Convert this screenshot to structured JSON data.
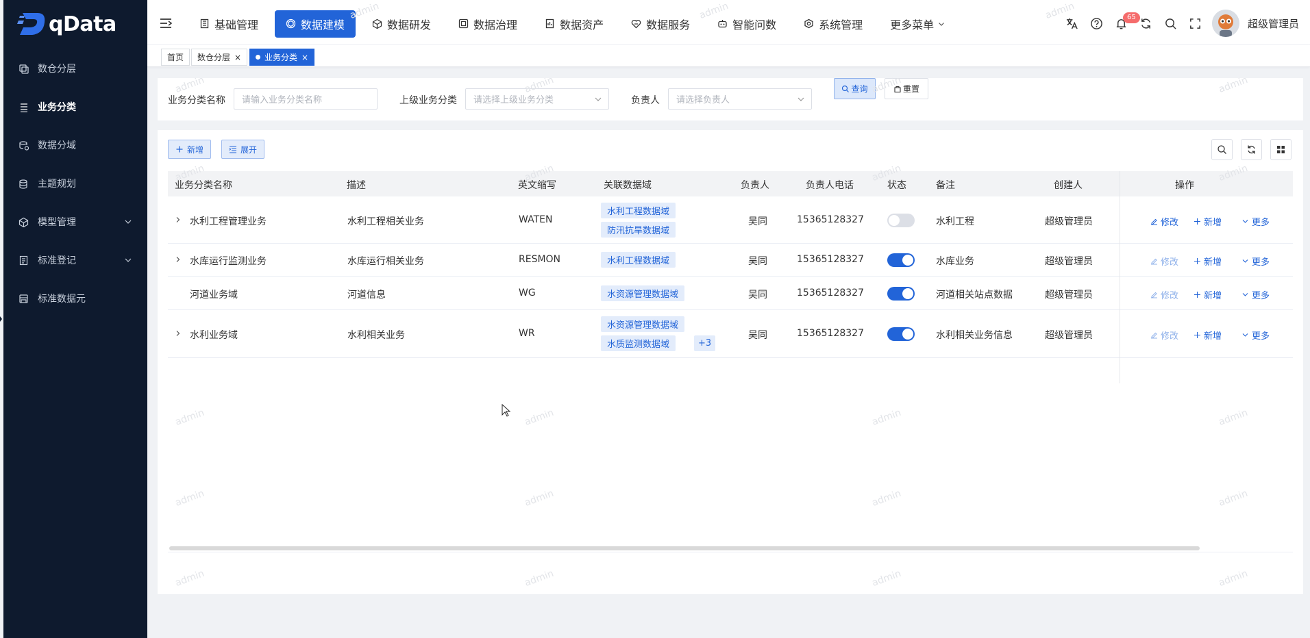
{
  "app": {
    "logo_text": "qData"
  },
  "sidebar": {
    "items": [
      {
        "label": "数仓分层",
        "icon": "layers-icon",
        "active": false,
        "has_children": false
      },
      {
        "label": "业务分类",
        "icon": "list-icon",
        "active": true,
        "has_children": false
      },
      {
        "label": "数据分域",
        "icon": "database-domain-icon",
        "active": false,
        "has_children": false
      },
      {
        "label": "主题规划",
        "icon": "topic-icon",
        "active": false,
        "has_children": false
      },
      {
        "label": "模型管理",
        "icon": "cube-icon",
        "active": false,
        "has_children": true
      },
      {
        "label": "标准登记",
        "icon": "doc-icon",
        "active": false,
        "has_children": true
      },
      {
        "label": "标准数据元",
        "icon": "save-icon",
        "active": false,
        "has_children": false
      }
    ]
  },
  "topnav": {
    "items": [
      {
        "label": "基础管理",
        "icon": "building-icon",
        "active": false
      },
      {
        "label": "数据建模",
        "icon": "model-icon",
        "active": true
      },
      {
        "label": "数据研发",
        "icon": "cube-icon",
        "active": false
      },
      {
        "label": "数据治理",
        "icon": "govern-icon",
        "active": false
      },
      {
        "label": "数据资产",
        "icon": "asset-icon",
        "active": false
      },
      {
        "label": "数据服务",
        "icon": "service-icon",
        "active": false
      },
      {
        "label": "智能问数",
        "icon": "robot-icon",
        "active": false
      },
      {
        "label": "系统管理",
        "icon": "settings-icon",
        "active": false
      },
      {
        "label": "更多菜单",
        "icon": "",
        "active": false,
        "dropdown": true
      }
    ]
  },
  "header": {
    "notification_count": "65",
    "username": "超级管理员"
  },
  "tags": [
    {
      "label": "首页",
      "closable": false,
      "active": false
    },
    {
      "label": "数仓分层",
      "closable": true,
      "active": false
    },
    {
      "label": "业务分类",
      "closable": true,
      "active": true
    }
  ],
  "search": {
    "name_label": "业务分类名称",
    "name_placeholder": "请输入业务分类名称",
    "parent_label": "上级业务分类",
    "parent_placeholder": "请选择上级业务分类",
    "owner_label": "负责人",
    "owner_placeholder": "请选择负责人",
    "query_label": "查询",
    "reset_label": "重置"
  },
  "toolbar": {
    "add_label": "新增",
    "expand_label": "展开"
  },
  "table": {
    "columns": [
      "业务分类名称",
      "描述",
      "英文缩写",
      "关联数据域",
      "负责人",
      "负责人电话",
      "状态",
      "备注",
      "创建人",
      "操作"
    ],
    "rows": [
      {
        "name": "水利工程管理业务",
        "desc": "水利工程相关业务",
        "abbr": "WATEN",
        "domains": [
          "水利工程数据域",
          "防汛抗旱数据域"
        ],
        "extra": "",
        "owner": "吴同",
        "phone": "15365128327",
        "status": false,
        "remark": "水利工程",
        "creator": "超级管理员",
        "expandable": true
      },
      {
        "name": "水库运行监测业务",
        "desc": "水库运行相关业务",
        "abbr": "RESMON",
        "domains": [
          "水利工程数据域"
        ],
        "extra": "",
        "owner": "吴同",
        "phone": "15365128327",
        "status": true,
        "remark": "水库业务",
        "creator": "超级管理员",
        "expandable": true
      },
      {
        "name": "河道业务域",
        "desc": "河道信息",
        "abbr": "WG",
        "domains": [
          "水资源管理数据域"
        ],
        "extra": "",
        "owner": "吴同",
        "phone": "15365128327",
        "status": true,
        "remark": "河道相关站点数据",
        "creator": "超级管理员",
        "expandable": false
      },
      {
        "name": "水利业务域",
        "desc": "水利相关业务",
        "abbr": "WR",
        "domains": [
          "水资源管理数据域",
          "水质监测数据域"
        ],
        "extra": "+3",
        "owner": "吴同",
        "phone": "15365128327",
        "status": true,
        "remark": "水利相关业务信息",
        "creator": "超级管理员",
        "expandable": true
      }
    ],
    "ops": {
      "edit": "修改",
      "add": "新增",
      "more": "更多"
    }
  },
  "watermark": "admin",
  "colors": {
    "primary": "#2264d8",
    "sidebar_bg": "#0e1a2e",
    "badge": "#f56c6c"
  }
}
